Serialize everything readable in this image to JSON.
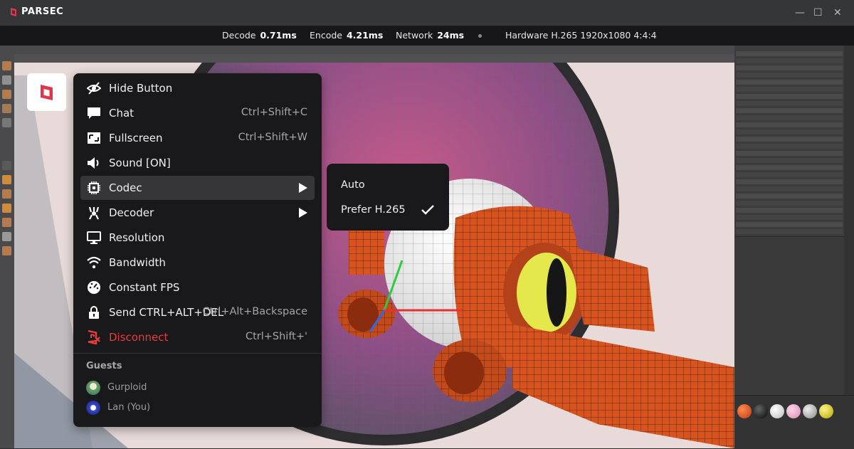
{
  "app": {
    "brand": "PARSEC",
    "window_controls": {
      "close": "✕",
      "maximize": "☐",
      "minimize": "—"
    }
  },
  "stats": [
    {
      "label": "Decode",
      "value": "0.71ms"
    },
    {
      "label": "Encode",
      "value": "4.21ms"
    },
    {
      "label": "Network",
      "value": "24ms"
    },
    {
      "label": "Hardware",
      "value": "H.265 1920x1080 4:4:4"
    }
  ],
  "menu": {
    "items": [
      {
        "label": "Hide Button",
        "shortcut": "",
        "icon": "eye-slash-icon"
      },
      {
        "label": "Chat",
        "shortcut": "Ctrl+Shift+C",
        "icon": "chat-bubble-icon"
      },
      {
        "label": "Fullscreen",
        "shortcut": "Ctrl+Shift+W",
        "icon": "fullscreen-icon"
      },
      {
        "label": "Sound [ON]",
        "shortcut": "",
        "icon": "speaker-icon"
      },
      {
        "label": "Codec",
        "shortcut": "",
        "icon": "chip-icon",
        "submenu": true,
        "active": true
      },
      {
        "label": "Decoder",
        "shortcut": "",
        "icon": "decoder-icon",
        "submenu": true
      },
      {
        "label": "Resolution",
        "shortcut": "",
        "icon": "monitor-icon"
      },
      {
        "label": "Bandwidth",
        "shortcut": "",
        "icon": "wifi-icon"
      },
      {
        "label": "Constant FPS",
        "shortcut": "",
        "icon": "gauge-icon"
      },
      {
        "label": "Send CTRL+ALT+DEL",
        "shortcut": "Ctrl+Alt+Backspace",
        "icon": "lock-icon"
      },
      {
        "label": "Disconnect",
        "shortcut": "Ctrl+Shift+'",
        "icon": "disconnect-icon",
        "danger": true
      }
    ],
    "guests_title": "Guests",
    "guests": [
      {
        "name": "Gurploid",
        "avatar": "avatar-gurploid"
      },
      {
        "name": "Lan (You)",
        "avatar": "avatar-lan"
      }
    ]
  },
  "codec_submenu": {
    "items": [
      {
        "label": "Auto",
        "selected": false
      },
      {
        "label": "Prefer H.265",
        "selected": true
      }
    ]
  },
  "colors": {
    "menu_bg": "#19191b",
    "active_row": "#363638",
    "danger": "#e53d3d",
    "brand_accent": "#e3344a",
    "stats_bg": "#141416"
  }
}
